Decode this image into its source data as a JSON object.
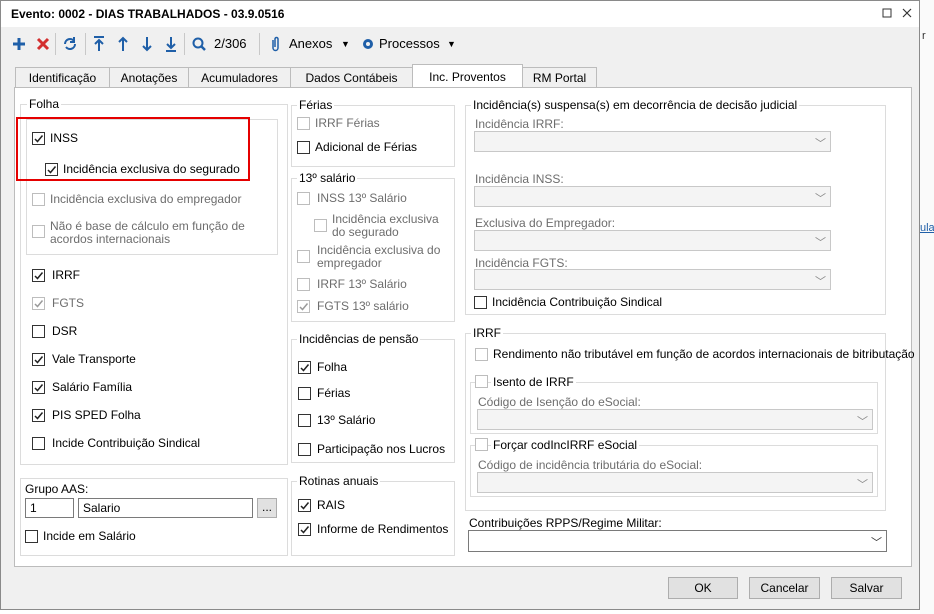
{
  "window": {
    "title": "Evento: 0002 - DIAS TRABALHADOS - 03.9.0516",
    "maximize_icon": "maximize-icon",
    "close_icon": "close-icon"
  },
  "toolbar": {
    "record_position": "2/306",
    "anexos": "Anexos",
    "processos": "Processos"
  },
  "tabs": [
    "Identificação",
    "Anotações",
    "Acumuladores",
    "Dados Contábeis",
    "Inc. Proventos",
    "RM Portal"
  ],
  "active_tab": "Inc. Proventos",
  "folha": {
    "title": "Folha",
    "inss": "INSS",
    "inc_excl_segurado": "Incidência exclusiva do segurado",
    "inc_excl_empregador": "Incidência exclusiva do empregador",
    "nao_base": "Não é base de cálculo em função de acordos internacionais",
    "irrf": "IRRF",
    "fgts": "FGTS",
    "dsr": "DSR",
    "vale_transporte": "Vale Transporte",
    "salario_familia": "Salário Família",
    "pis_sped": "PIS SPED Folha",
    "contrib_sindical": "Incide Contribuição Sindical"
  },
  "grupo_aas": {
    "label": "Grupo AAS:",
    "code": "1",
    "name": "Salario",
    "browse": "...",
    "incide_salario": "Incide em Salário"
  },
  "ferias": {
    "title": "Férias",
    "irrf_ferias": "IRRF Férias",
    "adicional": "Adicional de Férias"
  },
  "decimo": {
    "title": "13º salário",
    "inss": "INSS 13º Salário",
    "inc_segurado": "Incidência exclusiva do segurado",
    "inc_empregador": "Incidência exclusiva do empregador",
    "irrf": "IRRF 13º Salário",
    "fgts": "FGTS 13º salário"
  },
  "pensao": {
    "title": "Incidências de pensão",
    "folha": "Folha",
    "ferias": "Férias",
    "decimo": "13º Salário",
    "lucros": "Participação nos Lucros"
  },
  "rotinas": {
    "title": "Rotinas anuais",
    "rais": "RAIS",
    "informe": "Informe de Rendimentos"
  },
  "suspensa": {
    "title": "Incidência(s) suspensa(s) em decorrência de decisão judicial",
    "irrf": "Incidência IRRF:",
    "inss": "Incidência INSS:",
    "empregador": "Exclusiva do Empregador:",
    "fgts": "Incidência FGTS:",
    "contrib_sindical": "Incidência Contribuição Sindical"
  },
  "irrf_group": {
    "title": "IRRF",
    "rendimento": "Rendimento não tributável em função de acordos internacionais de bitributação",
    "isento": "Isento de IRRF",
    "codigo_isencao": "Código de Isenção do eSocial:",
    "forcar": "Forçar codIncIRRF eSocial",
    "codigo_incidencia": "Código de incidência tributária do eSocial:"
  },
  "contribuicoes": {
    "label": "Contribuições RPPS/Regime Militar:"
  },
  "footer": {
    "ok": "OK",
    "cancelar": "Cancelar",
    "salvar": "Salvar"
  },
  "colors": {
    "accent_blue": "#1f5fa8",
    "delete_red": "#d32f2f",
    "highlight_red": "#e50000"
  }
}
